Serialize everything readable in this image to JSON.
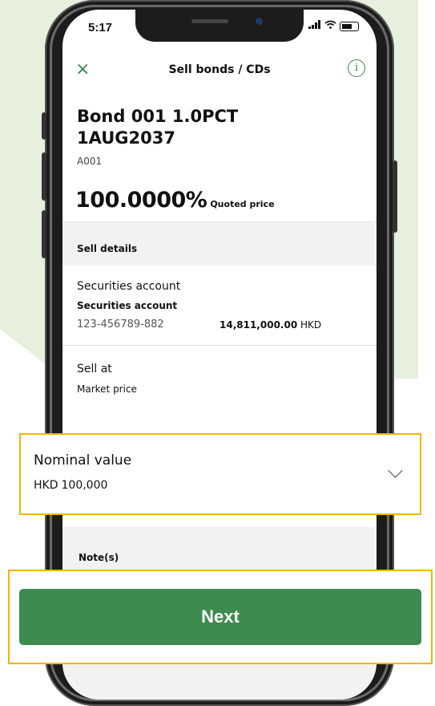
{
  "status_bar": {
    "time": "5:17"
  },
  "nav": {
    "close_glyph": "×",
    "title": "Sell bonds / CDs",
    "info_glyph": "i"
  },
  "bond": {
    "name": "Bond 001 1.0PCT 1AUG2037",
    "code": "A001",
    "price": "100.0000%",
    "price_label": "Quoted price"
  },
  "sell_details": {
    "header": "Sell details",
    "account_label": "Securities account",
    "account_sub": "Securities account",
    "account_number": "123-456789-882",
    "balance_amount": "14,811,000.00",
    "balance_currency": "HKD",
    "sell_at_label": "Sell at",
    "sell_at_value": "Market price"
  },
  "nominal": {
    "label": "Nominal value",
    "currency": "HKD",
    "amount": "100,000"
  },
  "notes": {
    "label": "Note(s)"
  },
  "actions": {
    "next_label": "Next"
  },
  "colors": {
    "accent_green": "#3d8c4f",
    "highlight_yellow": "#f4b400",
    "background_tint": "#e6f0dd"
  },
  "icons": [
    "close-icon",
    "info-icon",
    "chevron-down-icon",
    "signal-icon",
    "wifi-icon",
    "battery-icon"
  ]
}
